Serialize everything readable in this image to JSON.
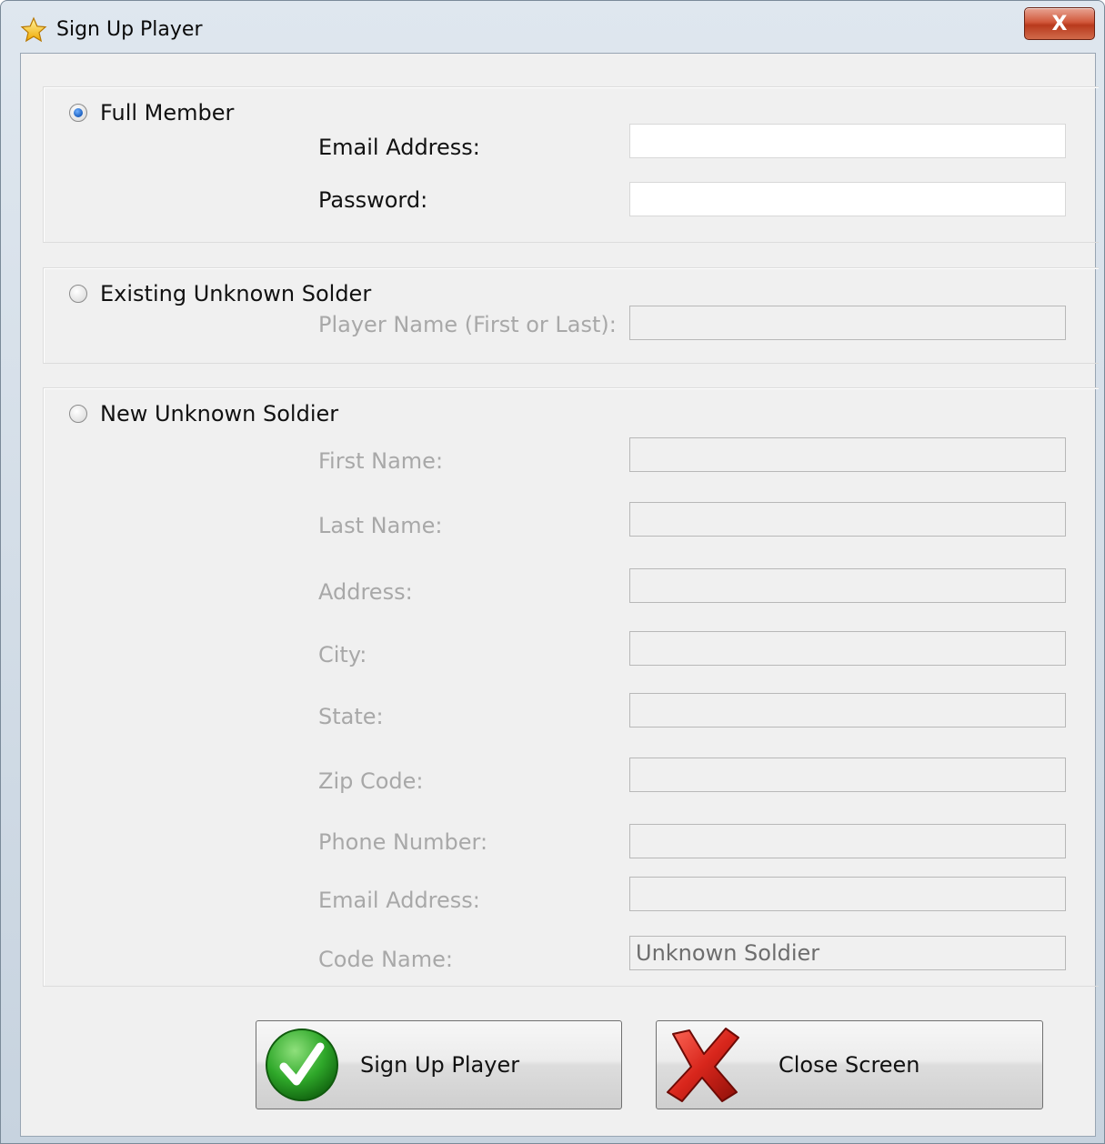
{
  "window": {
    "title": "Sign Up Player",
    "close_symbol": "X",
    "title_icon": "star-icon"
  },
  "full_member": {
    "option_label": "Full Member",
    "selected": true,
    "fields": {
      "email_label": "Email Address:",
      "email_value": "",
      "password_label": "Password:",
      "password_value": ""
    }
  },
  "existing_unknown": {
    "option_label": "Existing Unknown Solder",
    "selected": false,
    "fields": {
      "player_name_label": "Player Name (First or Last):",
      "player_name_value": ""
    }
  },
  "new_unknown": {
    "option_label": "New Unknown Soldier",
    "selected": false,
    "fields": {
      "first_name_label": "First Name:",
      "last_name_label": "Last Name:",
      "address_label": "Address:",
      "city_label": "City:",
      "state_label": "State:",
      "zip_label": "Zip Code:",
      "phone_label": "Phone Number:",
      "email_label": "Email Address:",
      "code_name_label": "Code Name:",
      "code_name_value": "Unknown Soldier"
    }
  },
  "buttons": {
    "sign_up_label": "Sign Up Player",
    "sign_up_icon": "checkmark-icon",
    "close_label": "Close Screen",
    "close_icon": "red-x-icon"
  },
  "colors": {
    "disabled_text": "#a8a8a8",
    "check_green": "#2fa82a",
    "x_red": "#d8261c"
  }
}
